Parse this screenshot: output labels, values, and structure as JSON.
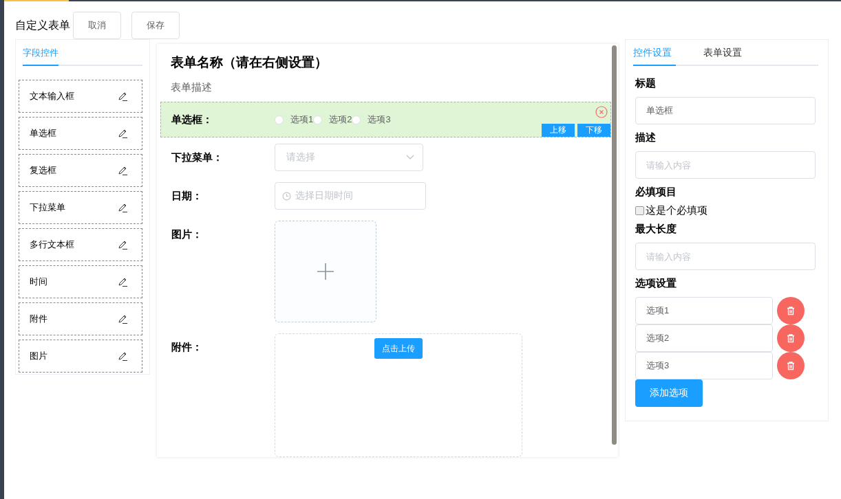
{
  "app_title": "自定义表单",
  "header_buttons": [
    "取消",
    "保存"
  ],
  "palette": {
    "tabs": [
      {
        "label": "字段控件",
        "selected": true
      }
    ],
    "items": [
      "文本输入框",
      "单选框",
      "复选框",
      "下拉菜单",
      "多行文本框",
      "时间",
      "附件",
      "图片"
    ]
  },
  "form": {
    "title": "表单名称（请在右侧设置）",
    "description": "表单描述",
    "move_buttons": [
      "上移",
      "下移"
    ],
    "fields": [
      {
        "kind": "radio",
        "label": "单选框：",
        "selected": true,
        "options": [
          {
            "label": "选项1",
            "selected": false
          },
          {
            "label": "选项2",
            "selected": false
          },
          {
            "label": "选项3",
            "selected": false
          }
        ]
      },
      {
        "kind": "select",
        "label": "下拉菜单：",
        "selected": false,
        "placeholder": "请选择"
      },
      {
        "kind": "datetime",
        "label": "日期：",
        "selected": false,
        "placeholder": "选择日期时间"
      },
      {
        "kind": "image",
        "label": "图片：",
        "selected": false
      },
      {
        "kind": "upload",
        "label": "附件：",
        "selected": false,
        "button": "点击上传"
      }
    ]
  },
  "settings": {
    "tabs": [
      {
        "label": "控件设置",
        "selected": true
      },
      {
        "label": "表单设置",
        "selected": false
      }
    ],
    "sections": [
      {
        "kind": "input",
        "title": "标题",
        "value": "单选框"
      },
      {
        "kind": "input",
        "title": "描述",
        "placeholder": "请输入内容"
      },
      {
        "kind": "checkbox",
        "title": "必填项目",
        "label": "这是个必填项",
        "checked": false
      },
      {
        "kind": "input",
        "title": "最大长度",
        "placeholder": "请输入内容"
      },
      {
        "kind": "options",
        "title": "选项设置",
        "options": [
          "选项1",
          "选项2",
          "选项3"
        ],
        "add_button": "添加选项"
      }
    ]
  }
}
